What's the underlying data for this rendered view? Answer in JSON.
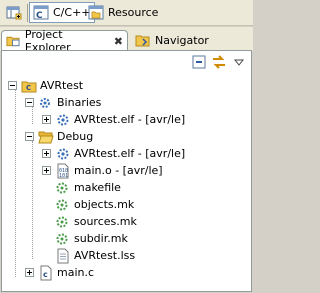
{
  "perspectives": {
    "items": [
      {
        "label": "C/C++",
        "icon": "c-cpp-perspective-icon",
        "active": true
      },
      {
        "label": "Resource",
        "icon": "resource-perspective-icon",
        "active": false
      }
    ]
  },
  "tabs": [
    {
      "label": "Project Explorer",
      "icon": "project-explorer-icon",
      "active": true,
      "close": "✖"
    },
    {
      "label": "Navigator",
      "icon": "navigator-icon",
      "active": false
    }
  ],
  "view_toolbar": {
    "collapse_all": "collapse-all-icon",
    "link_with_editor": "link-with-editor-icon",
    "view_menu": "view-menu-icon"
  },
  "tree": {
    "project": "AVRtest",
    "binaries": {
      "label": "Binaries",
      "items": [
        "AVRtest.elf - [avr/le]"
      ]
    },
    "debug": {
      "label": "Debug",
      "items": [
        "AVRtest.elf - [avr/le]",
        "main.o - [avr/le]",
        "makefile",
        "objects.mk",
        "sources.mk",
        "subdir.mk",
        "AVRtest.lss"
      ]
    },
    "source": "main.c"
  },
  "colors": {
    "panel": "#ece9d8",
    "view_bg": "#ffffff",
    "folder": "#f2c64b",
    "elf_gear": "#3b6fb6"
  }
}
